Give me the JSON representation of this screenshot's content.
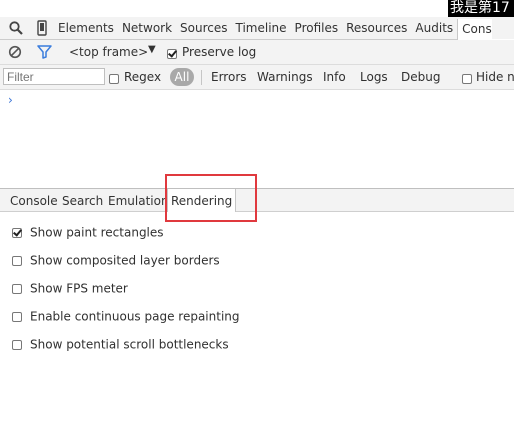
{
  "overlay_text": "我是第17",
  "toolbar": {
    "tabs": [
      {
        "label": "Elements"
      },
      {
        "label": "Network"
      },
      {
        "label": "Sources"
      },
      {
        "label": "Timeline"
      },
      {
        "label": "Profiles"
      },
      {
        "label": "Resources"
      },
      {
        "label": "Audits"
      },
      {
        "label": "Console",
        "active": true
      }
    ]
  },
  "console_toolbar": {
    "frame_selector": "<top frame>",
    "preserve_log_label": "Preserve log",
    "preserve_log_checked": true
  },
  "filter_bar": {
    "filter_placeholder": "Filter",
    "regex_label": "Regex",
    "levels": [
      "All",
      "Errors",
      "Warnings",
      "Info",
      "Logs",
      "Debug"
    ],
    "active_level": "All",
    "hide_network_label": "Hide ne"
  },
  "console": {
    "prompt_symbol": "›"
  },
  "drawer": {
    "tabs": [
      {
        "label": "Console"
      },
      {
        "label": "Search"
      },
      {
        "label": "Emulation"
      },
      {
        "label": "Rendering",
        "active": true
      }
    ],
    "options": [
      {
        "label": "Show paint rectangles",
        "checked": true
      },
      {
        "label": "Show composited layer borders",
        "checked": false
      },
      {
        "label": "Show FPS meter",
        "checked": false
      },
      {
        "label": "Enable continuous page repainting",
        "checked": false
      },
      {
        "label": "Show potential scroll bottlenecks",
        "checked": false
      }
    ]
  },
  "colors": {
    "accent_blue": "#3873d6",
    "highlight_red": "#e0393e",
    "toolbar_bg": "#f3f3f3"
  }
}
